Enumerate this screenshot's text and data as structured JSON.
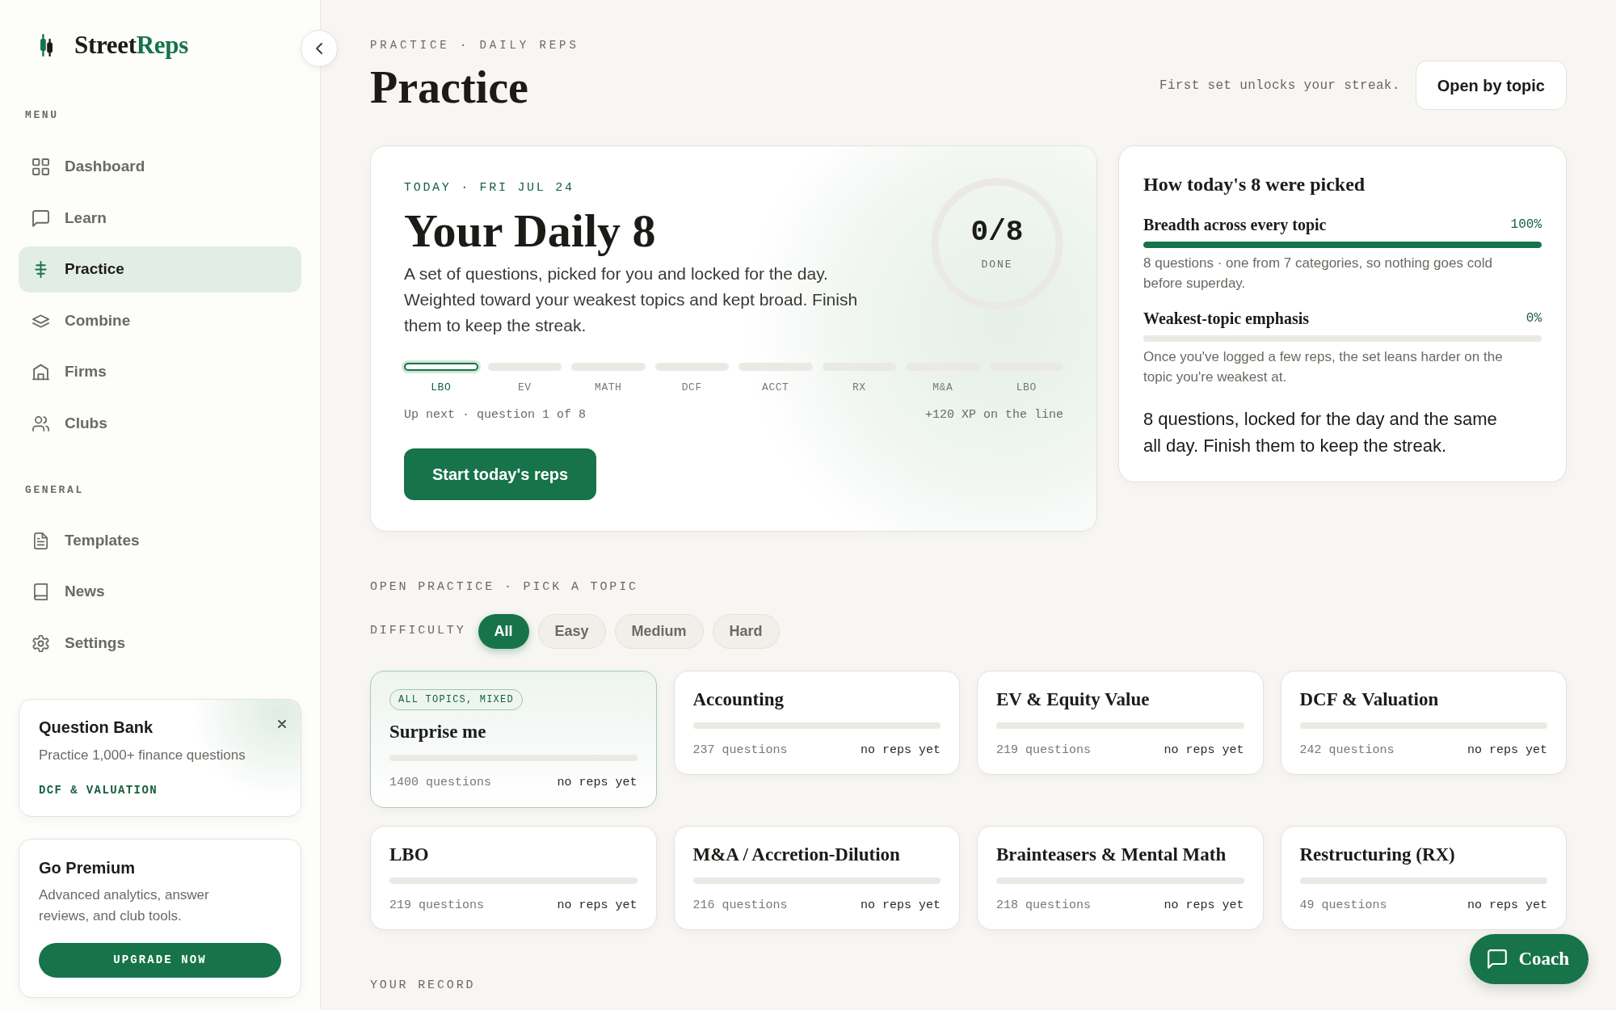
{
  "sidebar": {
    "logo": {
      "text": "Street",
      "accent": "Reps"
    },
    "sections": [
      {
        "label": "MENU",
        "items": [
          {
            "label": "Dashboard",
            "selected": false
          },
          {
            "label": "Learn",
            "selected": false
          },
          {
            "label": "Practice",
            "selected": true
          },
          {
            "label": "Combine",
            "selected": false
          },
          {
            "label": "Firms",
            "selected": false
          },
          {
            "label": "Clubs",
            "selected": false
          }
        ]
      },
      {
        "label": "GENERAL",
        "items": [
          {
            "label": "Templates",
            "selected": false
          },
          {
            "label": "News",
            "selected": false
          },
          {
            "label": "Settings",
            "selected": false
          }
        ]
      }
    ],
    "question_bank": {
      "title": "Question Bank",
      "text": "Practice 1,000+ finance questions",
      "tag": "DCF & VALUATION"
    },
    "premium": {
      "title": "Go Premium",
      "text": "Advanced analytics, answer reviews, and club tools.",
      "button": "UPGRADE NOW"
    }
  },
  "header": {
    "eyebrow": "PRACTICE · DAILY REPS",
    "title": "Practice",
    "note": "First set unlocks your streak.",
    "button": "Open by topic"
  },
  "daily": {
    "eyebrow": "TODAY · FRI JUL 24",
    "title": "Your Daily 8",
    "text": "A set of questions, picked for you and locked for the day. Weighted toward your weakest topics and kept broad. Finish them to keep the streak.",
    "progress": {
      "value": "0/8",
      "caption": "DONE"
    },
    "steps": [
      {
        "label": "LBO",
        "selected": true
      },
      {
        "label": "EV",
        "selected": false
      },
      {
        "label": "MATH",
        "selected": false
      },
      {
        "label": "DCF",
        "selected": false
      },
      {
        "label": "ACCT",
        "selected": false
      },
      {
        "label": "RX",
        "selected": false
      },
      {
        "label": "M&A",
        "selected": false
      },
      {
        "label": "LBO",
        "selected": false
      }
    ],
    "status": "Up next · question 1 of 8",
    "reward": "+120 XP on the line",
    "button": "Start today's reps"
  },
  "picking": {
    "title": "How today's 8 were picked",
    "factors": [
      {
        "name": "Breadth across every topic",
        "reading": "100%",
        "level": 1,
        "text": "8 questions · one from 7 categories, so nothing goes cold before superday."
      },
      {
        "name": "Weakest-topic emphasis",
        "reading": "0%",
        "level": 0,
        "text": "Once you've logged a few reps, the set leans harder on the topic you're weakest at."
      }
    ],
    "summary": "8 questions, locked for the day and the same all day. Finish them to keep the streak."
  },
  "open_practice": {
    "heading": "OPEN PRACTICE · PICK A TOPIC",
    "filter_label": "DIFFICULTY",
    "filters": [
      {
        "label": "All",
        "selected": true
      },
      {
        "label": "Easy",
        "selected": false
      },
      {
        "label": "Medium",
        "selected": false
      },
      {
        "label": "Hard",
        "selected": false
      }
    ],
    "topics": [
      {
        "kind": "mixed",
        "tag": "ALL TOPICS, MIXED",
        "title": "Surprise me",
        "count": "1400 questions",
        "status": "no reps yet",
        "level": 0
      },
      {
        "kind": "topic",
        "title": "Accounting",
        "count": "237 questions",
        "status": "no reps yet",
        "level": 0
      },
      {
        "kind": "topic",
        "title": "EV & Equity Value",
        "count": "219 questions",
        "status": "no reps yet",
        "level": 0
      },
      {
        "kind": "topic",
        "title": "DCF & Valuation",
        "count": "242 questions",
        "status": "no reps yet",
        "level": 0
      },
      {
        "kind": "topic",
        "title": "LBO",
        "count": "219 questions",
        "status": "no reps yet",
        "level": 0
      },
      {
        "kind": "topic",
        "title": "M&A / Accretion-Dilution",
        "count": "216 questions",
        "status": "no reps yet",
        "level": 0
      },
      {
        "kind": "topic",
        "title": "Brainteasers & Mental Math",
        "count": "218 questions",
        "status": "no reps yet",
        "level": 0
      },
      {
        "kind": "topic",
        "title": "Restructuring (RX)",
        "count": "49 questions",
        "status": "no reps yet",
        "level": 0
      }
    ]
  },
  "record": {
    "heading": "YOUR RECORD"
  },
  "coach_button": "Coach"
}
